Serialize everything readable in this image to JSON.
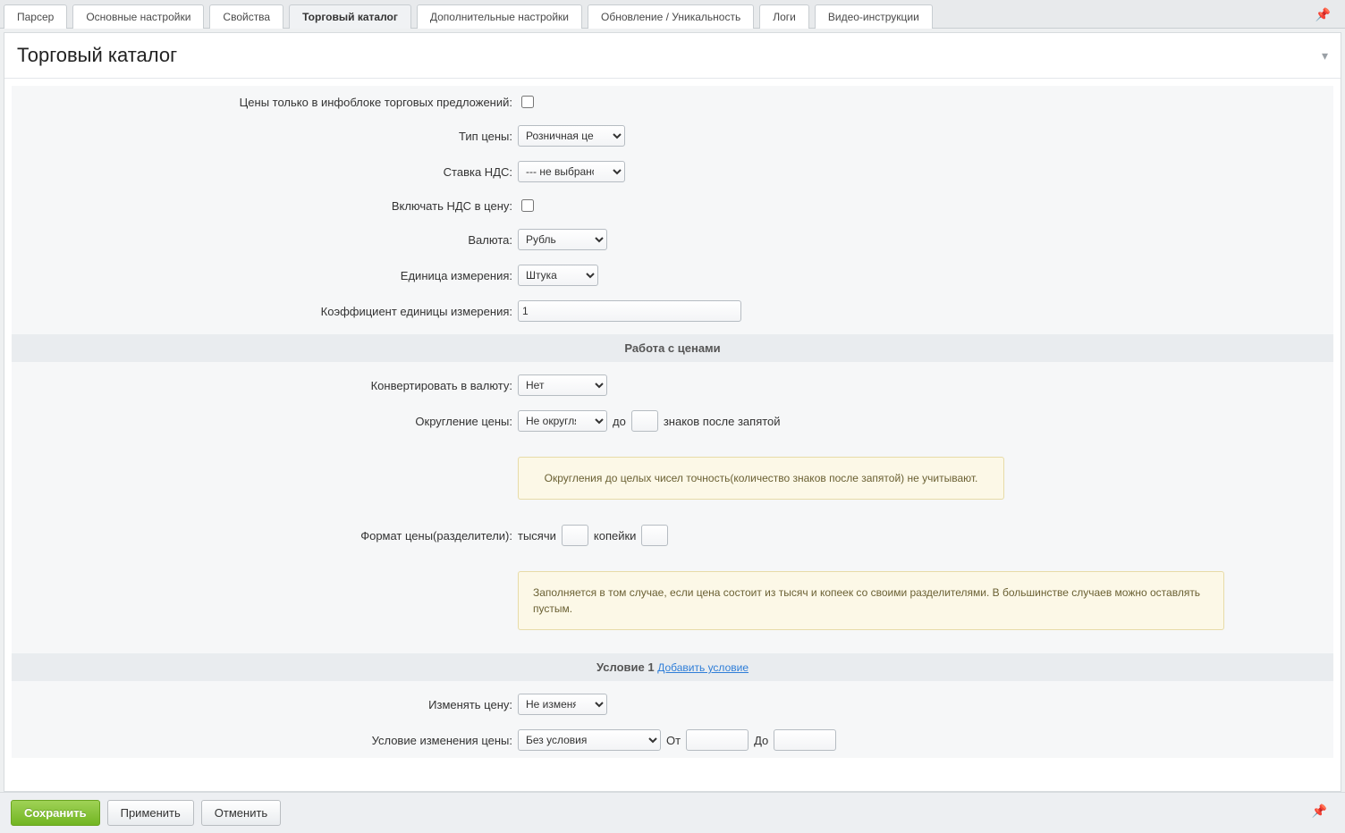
{
  "tabs": {
    "parser": "Парсер",
    "main_settings": "Основные настройки",
    "properties": "Свойства",
    "catalog": "Торговый каталог",
    "extra_settings": "Дополнительные настройки",
    "update": "Обновление / Уникальность",
    "logs": "Логи",
    "video": "Видео-инструкции"
  },
  "page_title": "Торговый каталог",
  "form": {
    "prices_only_in_offers_iblock": "Цены только в инфоблоке торговых предложений:",
    "price_type_label": "Тип цены:",
    "price_type_value": "Розничная цена",
    "vat_rate_label": "Ставка НДС:",
    "vat_rate_value": "--- не выбрано ---",
    "include_vat_label": "Включать НДС в цену:",
    "currency_label": "Валюта:",
    "currency_value": "Рубль",
    "unit_label": "Единица измерения:",
    "unit_value": "Штука",
    "unit_coef_label": "Коэффициент единицы измерения:",
    "unit_coef_value": "1"
  },
  "section_prices": "Работа с ценами",
  "prices": {
    "convert_label": "Конвертировать в валюту:",
    "convert_value": "Нет",
    "round_label": "Округление цены:",
    "round_value": "Не округлять",
    "round_to_label": "до",
    "round_after_label": "знаков после запятой",
    "round_note": "Округления до целых чисел точность(количество знаков после запятой) не учитывают.",
    "format_label": "Формат цены(разделители):",
    "format_thousands": "тысячи",
    "format_kopeks": "копейки",
    "format_note": "Заполняется в том случае, если цена состоит из тысяч и копеек со своими разделителями. В большинстве случаев можно оставлять пустым."
  },
  "section_condition_prefix": "Условие 1",
  "section_condition_link": "Добавить условие",
  "condition": {
    "change_label": "Изменять цену:",
    "change_value": "Не изменять",
    "cond_label": "Условие изменения цены:",
    "cond_value": "Без условия",
    "from_label": "От",
    "to_label": "До"
  },
  "footer": {
    "save": "Сохранить",
    "apply": "Применить",
    "cancel": "Отменить"
  }
}
